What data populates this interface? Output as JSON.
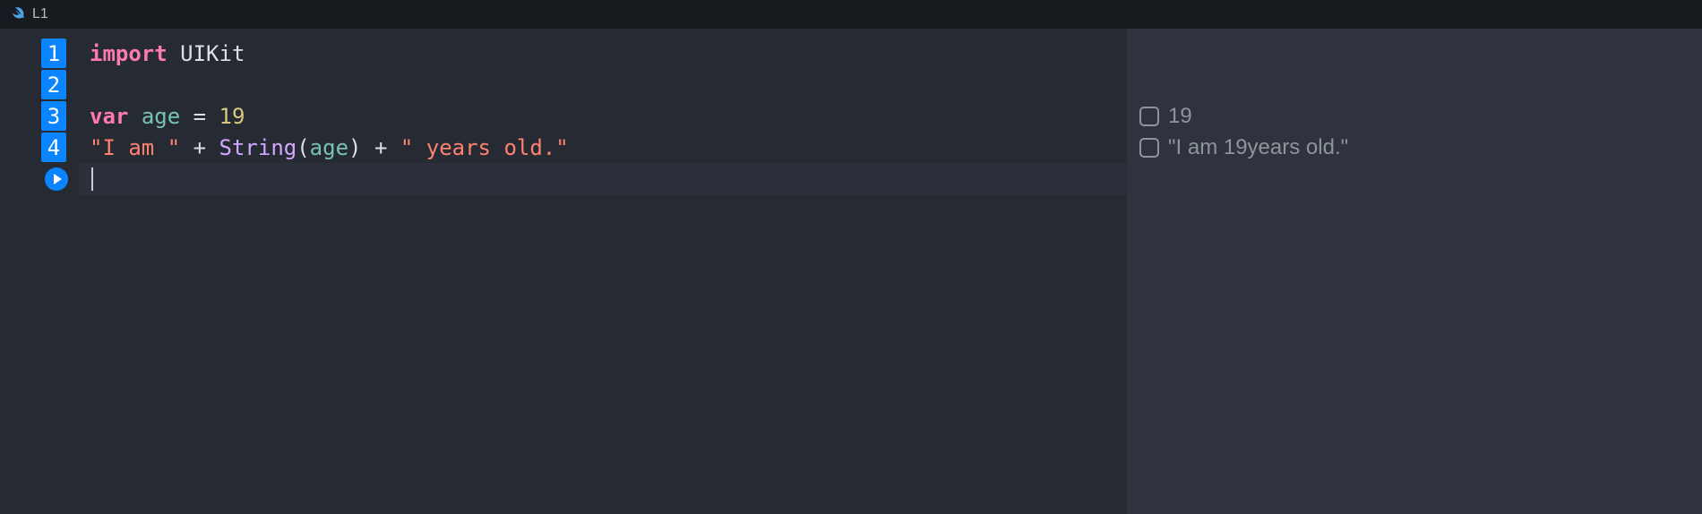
{
  "titlebar": {
    "title": "L1"
  },
  "code": {
    "lines": [
      {
        "num": "1",
        "tokens": [
          {
            "cls": "tk-keyword",
            "text": "import"
          },
          {
            "cls": "",
            "text": " "
          },
          {
            "cls": "tk-module",
            "text": "UIKit"
          }
        ]
      },
      {
        "num": "2",
        "tokens": []
      },
      {
        "num": "3",
        "tokens": [
          {
            "cls": "tk-keyword",
            "text": "var"
          },
          {
            "cls": "",
            "text": " "
          },
          {
            "cls": "tk-var",
            "text": "age"
          },
          {
            "cls": "",
            "text": " "
          },
          {
            "cls": "tk-op",
            "text": "="
          },
          {
            "cls": "",
            "text": " "
          },
          {
            "cls": "tk-number",
            "text": "19"
          }
        ]
      },
      {
        "num": "4",
        "tokens": [
          {
            "cls": "tk-string",
            "text": "\"I am \""
          },
          {
            "cls": "",
            "text": " "
          },
          {
            "cls": "tk-op",
            "text": "+"
          },
          {
            "cls": "",
            "text": " "
          },
          {
            "cls": "tk-type",
            "text": "String"
          },
          {
            "cls": "tk-paren",
            "text": "("
          },
          {
            "cls": "tk-var",
            "text": "age"
          },
          {
            "cls": "tk-paren",
            "text": ")"
          },
          {
            "cls": "",
            "text": " "
          },
          {
            "cls": "tk-op",
            "text": "+"
          },
          {
            "cls": "",
            "text": " "
          },
          {
            "cls": "tk-string",
            "text": "\" years old.\""
          }
        ]
      }
    ]
  },
  "results": [
    {
      "value": "19"
    },
    {
      "value": "\"I am 19years old.\""
    }
  ]
}
